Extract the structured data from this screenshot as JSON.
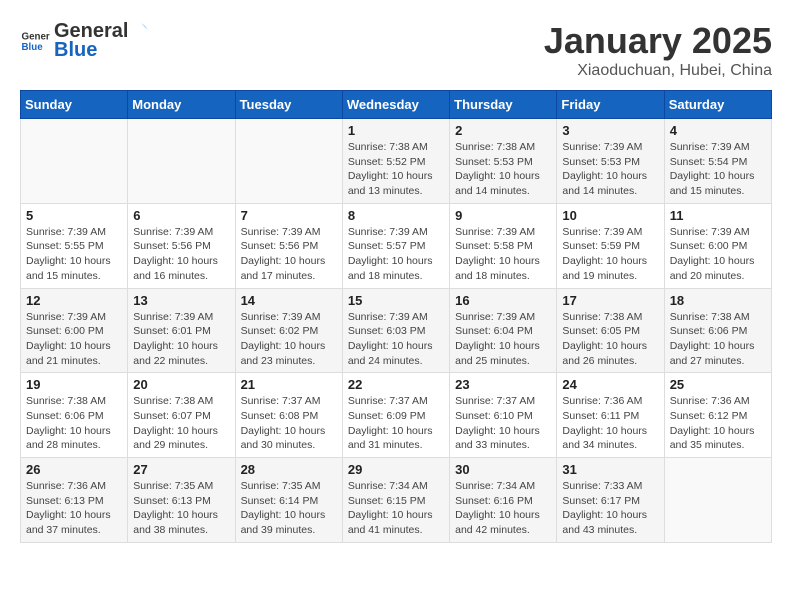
{
  "header": {
    "logo_general": "General",
    "logo_blue": "Blue",
    "title": "January 2025",
    "subtitle": "Xiaoduchuan, Hubei, China"
  },
  "weekdays": [
    "Sunday",
    "Monday",
    "Tuesday",
    "Wednesday",
    "Thursday",
    "Friday",
    "Saturday"
  ],
  "weeks": [
    [
      {
        "day": "",
        "sunrise": "",
        "sunset": "",
        "daylight": ""
      },
      {
        "day": "",
        "sunrise": "",
        "sunset": "",
        "daylight": ""
      },
      {
        "day": "",
        "sunrise": "",
        "sunset": "",
        "daylight": ""
      },
      {
        "day": "1",
        "sunrise": "7:38 AM",
        "sunset": "5:52 PM",
        "daylight": "10 hours and 13 minutes."
      },
      {
        "day": "2",
        "sunrise": "7:38 AM",
        "sunset": "5:53 PM",
        "daylight": "10 hours and 14 minutes."
      },
      {
        "day": "3",
        "sunrise": "7:39 AM",
        "sunset": "5:53 PM",
        "daylight": "10 hours and 14 minutes."
      },
      {
        "day": "4",
        "sunrise": "7:39 AM",
        "sunset": "5:54 PM",
        "daylight": "10 hours and 15 minutes."
      }
    ],
    [
      {
        "day": "5",
        "sunrise": "7:39 AM",
        "sunset": "5:55 PM",
        "daylight": "10 hours and 15 minutes."
      },
      {
        "day": "6",
        "sunrise": "7:39 AM",
        "sunset": "5:56 PM",
        "daylight": "10 hours and 16 minutes."
      },
      {
        "day": "7",
        "sunrise": "7:39 AM",
        "sunset": "5:56 PM",
        "daylight": "10 hours and 17 minutes."
      },
      {
        "day": "8",
        "sunrise": "7:39 AM",
        "sunset": "5:57 PM",
        "daylight": "10 hours and 18 minutes."
      },
      {
        "day": "9",
        "sunrise": "7:39 AM",
        "sunset": "5:58 PM",
        "daylight": "10 hours and 18 minutes."
      },
      {
        "day": "10",
        "sunrise": "7:39 AM",
        "sunset": "5:59 PM",
        "daylight": "10 hours and 19 minutes."
      },
      {
        "day": "11",
        "sunrise": "7:39 AM",
        "sunset": "6:00 PM",
        "daylight": "10 hours and 20 minutes."
      }
    ],
    [
      {
        "day": "12",
        "sunrise": "7:39 AM",
        "sunset": "6:00 PM",
        "daylight": "10 hours and 21 minutes."
      },
      {
        "day": "13",
        "sunrise": "7:39 AM",
        "sunset": "6:01 PM",
        "daylight": "10 hours and 22 minutes."
      },
      {
        "day": "14",
        "sunrise": "7:39 AM",
        "sunset": "6:02 PM",
        "daylight": "10 hours and 23 minutes."
      },
      {
        "day": "15",
        "sunrise": "7:39 AM",
        "sunset": "6:03 PM",
        "daylight": "10 hours and 24 minutes."
      },
      {
        "day": "16",
        "sunrise": "7:39 AM",
        "sunset": "6:04 PM",
        "daylight": "10 hours and 25 minutes."
      },
      {
        "day": "17",
        "sunrise": "7:38 AM",
        "sunset": "6:05 PM",
        "daylight": "10 hours and 26 minutes."
      },
      {
        "day": "18",
        "sunrise": "7:38 AM",
        "sunset": "6:06 PM",
        "daylight": "10 hours and 27 minutes."
      }
    ],
    [
      {
        "day": "19",
        "sunrise": "7:38 AM",
        "sunset": "6:06 PM",
        "daylight": "10 hours and 28 minutes."
      },
      {
        "day": "20",
        "sunrise": "7:38 AM",
        "sunset": "6:07 PM",
        "daylight": "10 hours and 29 minutes."
      },
      {
        "day": "21",
        "sunrise": "7:37 AM",
        "sunset": "6:08 PM",
        "daylight": "10 hours and 30 minutes."
      },
      {
        "day": "22",
        "sunrise": "7:37 AM",
        "sunset": "6:09 PM",
        "daylight": "10 hours and 31 minutes."
      },
      {
        "day": "23",
        "sunrise": "7:37 AM",
        "sunset": "6:10 PM",
        "daylight": "10 hours and 33 minutes."
      },
      {
        "day": "24",
        "sunrise": "7:36 AM",
        "sunset": "6:11 PM",
        "daylight": "10 hours and 34 minutes."
      },
      {
        "day": "25",
        "sunrise": "7:36 AM",
        "sunset": "6:12 PM",
        "daylight": "10 hours and 35 minutes."
      }
    ],
    [
      {
        "day": "26",
        "sunrise": "7:36 AM",
        "sunset": "6:13 PM",
        "daylight": "10 hours and 37 minutes."
      },
      {
        "day": "27",
        "sunrise": "7:35 AM",
        "sunset": "6:13 PM",
        "daylight": "10 hours and 38 minutes."
      },
      {
        "day": "28",
        "sunrise": "7:35 AM",
        "sunset": "6:14 PM",
        "daylight": "10 hours and 39 minutes."
      },
      {
        "day": "29",
        "sunrise": "7:34 AM",
        "sunset": "6:15 PM",
        "daylight": "10 hours and 41 minutes."
      },
      {
        "day": "30",
        "sunrise": "7:34 AM",
        "sunset": "6:16 PM",
        "daylight": "10 hours and 42 minutes."
      },
      {
        "day": "31",
        "sunrise": "7:33 AM",
        "sunset": "6:17 PM",
        "daylight": "10 hours and 43 minutes."
      },
      {
        "day": "",
        "sunrise": "",
        "sunset": "",
        "daylight": ""
      }
    ]
  ]
}
